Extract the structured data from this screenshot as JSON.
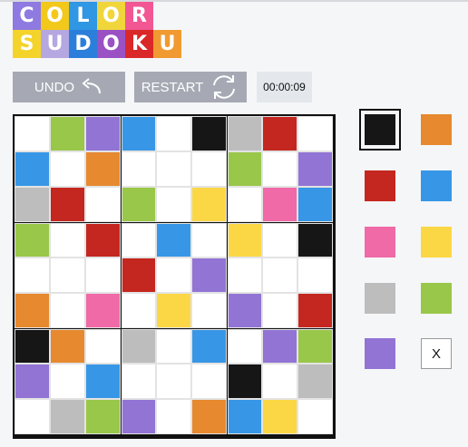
{
  "logo": {
    "row1": [
      {
        "letter": "C",
        "color": "#8e7ae0"
      },
      {
        "letter": "O",
        "color": "#f2c81a"
      },
      {
        "letter": "L",
        "color": "#2f97e3"
      },
      {
        "letter": "O",
        "color": "#f0d63a"
      },
      {
        "letter": "R",
        "color": "#f25794"
      }
    ],
    "row2": [
      {
        "letter": "S",
        "color": "#f4d42a"
      },
      {
        "letter": "U",
        "color": "#b5a7e0"
      },
      {
        "letter": "D",
        "color": "#2b7fdb"
      },
      {
        "letter": "O",
        "color": "#9a51c4"
      },
      {
        "letter": "K",
        "color": "#da2727"
      },
      {
        "letter": "U",
        "color": "#f09a31"
      }
    ]
  },
  "controls": {
    "undo_label": "UNDO",
    "restart_label": "RESTART",
    "timer": "00:00:09"
  },
  "colors": {
    "K": "#161616",
    "O": "#e6892f",
    "R": "#c4271f",
    "B": "#3797e6",
    "P": "#ef6aa7",
    "Y": "#fbd745",
    "G": "#bdbdbd",
    "L": "#99c749",
    "V": "#9274d5",
    "_": "#ffffff"
  },
  "board": [
    [
      "_",
      "L",
      "V",
      "B",
      "_",
      "K",
      "G",
      "R",
      "_"
    ],
    [
      "B",
      "_",
      "O",
      "_",
      "_",
      "_",
      "L",
      "_",
      "V"
    ],
    [
      "G",
      "R",
      "_",
      "L",
      "_",
      "Y",
      "_",
      "P",
      "B"
    ],
    [
      "L",
      "_",
      "R",
      "_",
      "B",
      "_",
      "Y",
      "_",
      "K"
    ],
    [
      "_",
      "_",
      "_",
      "R",
      "_",
      "V",
      "_",
      "_",
      "_"
    ],
    [
      "O",
      "_",
      "P",
      "_",
      "Y",
      "_",
      "V",
      "_",
      "R"
    ],
    [
      "K",
      "O",
      "_",
      "G",
      "_",
      "B",
      "_",
      "V",
      "L"
    ],
    [
      "V",
      "_",
      "B",
      "_",
      "_",
      "_",
      "K",
      "_",
      "G"
    ],
    [
      "_",
      "G",
      "L",
      "V",
      "_",
      "O",
      "B",
      "Y",
      "_"
    ]
  ],
  "palette": {
    "selected": "K",
    "items": [
      {
        "code": "K",
        "name": "black"
      },
      {
        "code": "O",
        "name": "orange"
      },
      {
        "code": "R",
        "name": "red"
      },
      {
        "code": "B",
        "name": "blue"
      },
      {
        "code": "P",
        "name": "pink"
      },
      {
        "code": "Y",
        "name": "yellow"
      },
      {
        "code": "G",
        "name": "gray"
      },
      {
        "code": "L",
        "name": "green"
      },
      {
        "code": "V",
        "name": "purple"
      },
      {
        "code": "X",
        "name": "clear",
        "label": "X"
      }
    ]
  }
}
